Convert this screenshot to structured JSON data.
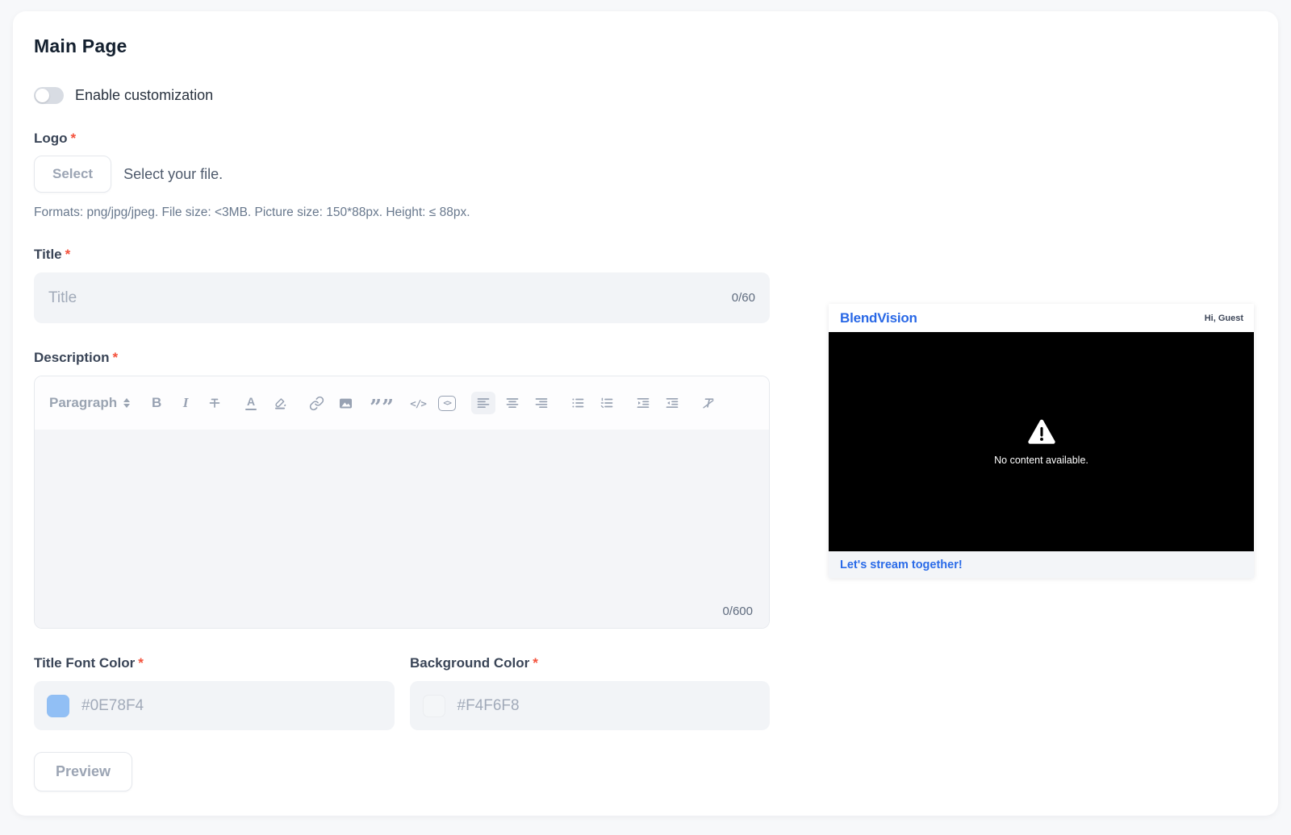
{
  "header": {
    "title": "Main Page"
  },
  "toggle": {
    "label": "Enable customization",
    "state": "off"
  },
  "logo": {
    "label": "Logo",
    "required_mark": "*",
    "select_button_label": "Select",
    "file_hint": "Select your file.",
    "format_hint": "Formats: png/jpg/jpeg. File size: <3MB. Picture size: 150*88px. Height: ≤ 88px."
  },
  "title_field": {
    "label": "Title",
    "required_mark": "*",
    "placeholder": "Title",
    "value": "",
    "counter": "0/60"
  },
  "description_field": {
    "label": "Description",
    "required_mark": "*",
    "counter": "0/600",
    "toolbar": {
      "paragraph_label": "Paragraph",
      "glyphs": {
        "bold": "B",
        "italic": "I",
        "font_color": "A",
        "blockquote": "””",
        "inline_code": "</>",
        "code_block": "<>"
      },
      "icons": [
        "paragraph-select",
        "bold",
        "italic",
        "strikethrough",
        "font-color",
        "highlight-color",
        "link",
        "image",
        "blockquote",
        "inline-code",
        "code-block",
        "align-left",
        "align-center",
        "align-right",
        "bullet-list",
        "ordered-list",
        "indent",
        "outdent",
        "clear-format"
      ],
      "active_icon": "align-left"
    }
  },
  "color_fields": {
    "title_font_color": {
      "label": "Title Font Color",
      "required_mark": "*",
      "value": "#0E78F4",
      "swatch_color": "#0E78F4"
    },
    "background_color": {
      "label": "Background Color",
      "required_mark": "*",
      "value": "#F4F6F8",
      "swatch_color": "#F4F6F8"
    }
  },
  "preview_button_label": "Preview",
  "preview_widget": {
    "brand": "BlendVision",
    "brand_color": "#2968E6",
    "greeting": "Hi, Guest",
    "empty_message": "No content available.",
    "footer_link": "Let's stream together!"
  }
}
